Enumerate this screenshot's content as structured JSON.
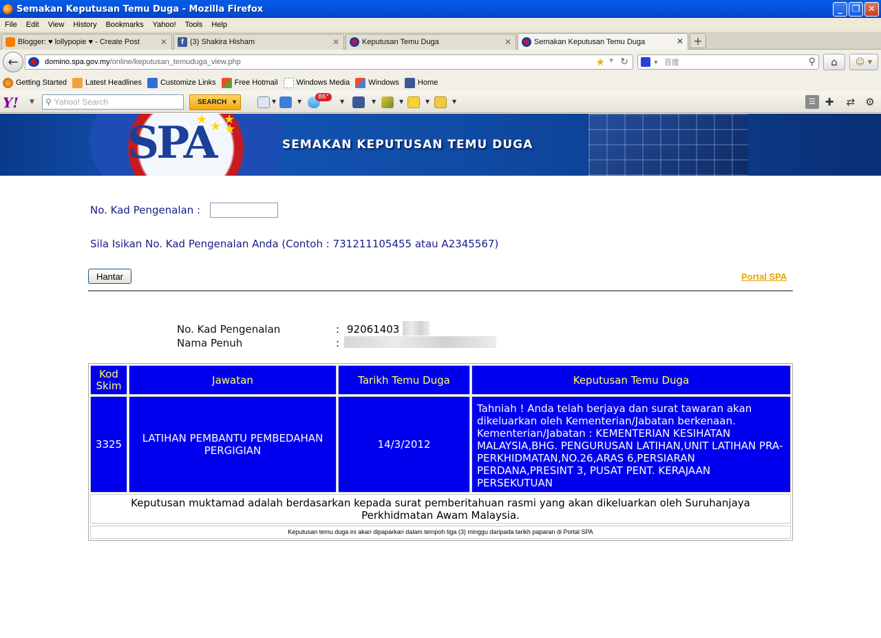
{
  "window": {
    "title": "Semakan Keputusan Temu Duga - Mozilla Firefox",
    "controls": [
      "_",
      "❐",
      "✕"
    ]
  },
  "menu": [
    "File",
    "Edit",
    "View",
    "History",
    "Bookmarks",
    "Yahoo!",
    "Tools",
    "Help"
  ],
  "tabs": [
    {
      "label": "Blogger: ♥ lollypopie ♥ - Create Post",
      "icon": "blogger-icon",
      "active": false
    },
    {
      "label": "(3) Shakira Hisham",
      "icon": "facebook-icon",
      "active": false
    },
    {
      "label": "Keputusan Temu Duga",
      "icon": "spa-icon",
      "active": false
    },
    {
      "label": "Semakan Keputusan Temu Duga",
      "icon": "spa-icon",
      "active": true
    }
  ],
  "navbar": {
    "url_domain": "domino.spa.gov.my",
    "url_path": "/online/keputusan_temuduga_view.php",
    "search_placeholder": "百度"
  },
  "bookmarks": [
    "Getting Started",
    "Latest Headlines",
    "Customize Links",
    "Free Hotmail",
    "Windows Media",
    "Windows",
    "Home"
  ],
  "yahoo_toolbar": {
    "logo": "Y!",
    "search_placeholder": "Yahoo! Search",
    "search_button": "SEARCH",
    "weather": "86°"
  },
  "page": {
    "banner_title": "SEMAKAN KEPUTUSAN TEMU DUGA",
    "banner_logo_text": "SPA",
    "form": {
      "label": "No. Kad Pengenalan :",
      "input_value": "",
      "hint": "Sila Isikan No. Kad Pengenalan Anda (Contoh : 731211105455 atau A2345567)",
      "submit_label": "Hantar",
      "portal_link": "Portal SPA"
    },
    "info": {
      "ic_label": "No. Kad Pengenalan",
      "ic_value": "92061403",
      "name_label": "Nama Penuh",
      "separator": ":"
    },
    "table": {
      "headers": [
        "Kod Skim",
        "Jawatan",
        "Tarikh Temu Duga",
        "Keputusan Temu Duga"
      ],
      "row": {
        "kod_skim": "3325",
        "jawatan": "LATIHAN PEMBANTU PEMBEDAHAN PERGIGIAN",
        "tarikh": "14/3/2012",
        "keputusan": "Tahniah ! Anda telah berjaya dan surat tawaran akan dikeluarkan oleh Kementerian/Jabatan berkenaan. Kementerian/Jabatan : KEMENTERIAN KESIHATAN MALAYSIA,BHG. PENGURUSAN LATIHAN,UNIT LATIHAN PRA-PERKHIDMATAN,NO.26,ARAS 6,PERSIARAN PERDANA,PRESINT 3, PUSAT PENT. KERAJAAN PERSEKUTUAN"
      },
      "note": "Keputusan muktamad adalah berdasarkan kepada surat pemberitahuan rasmi yang akan dikeluarkan oleh Suruhanjaya Perkhidmatan Awam Malaysia.",
      "footnote": "Keputusan temu duga ini akan dipaparkan dalam tempoh tiga (3) minggu daripada tarikh paparan di Portal SPA"
    }
  },
  "colors": {
    "titlebar": "#0453dd",
    "table_cell_bg": "#0000ee",
    "table_header_text": "#ffff66",
    "form_text": "#1a1a8c",
    "portal_link": "#e8a400"
  }
}
